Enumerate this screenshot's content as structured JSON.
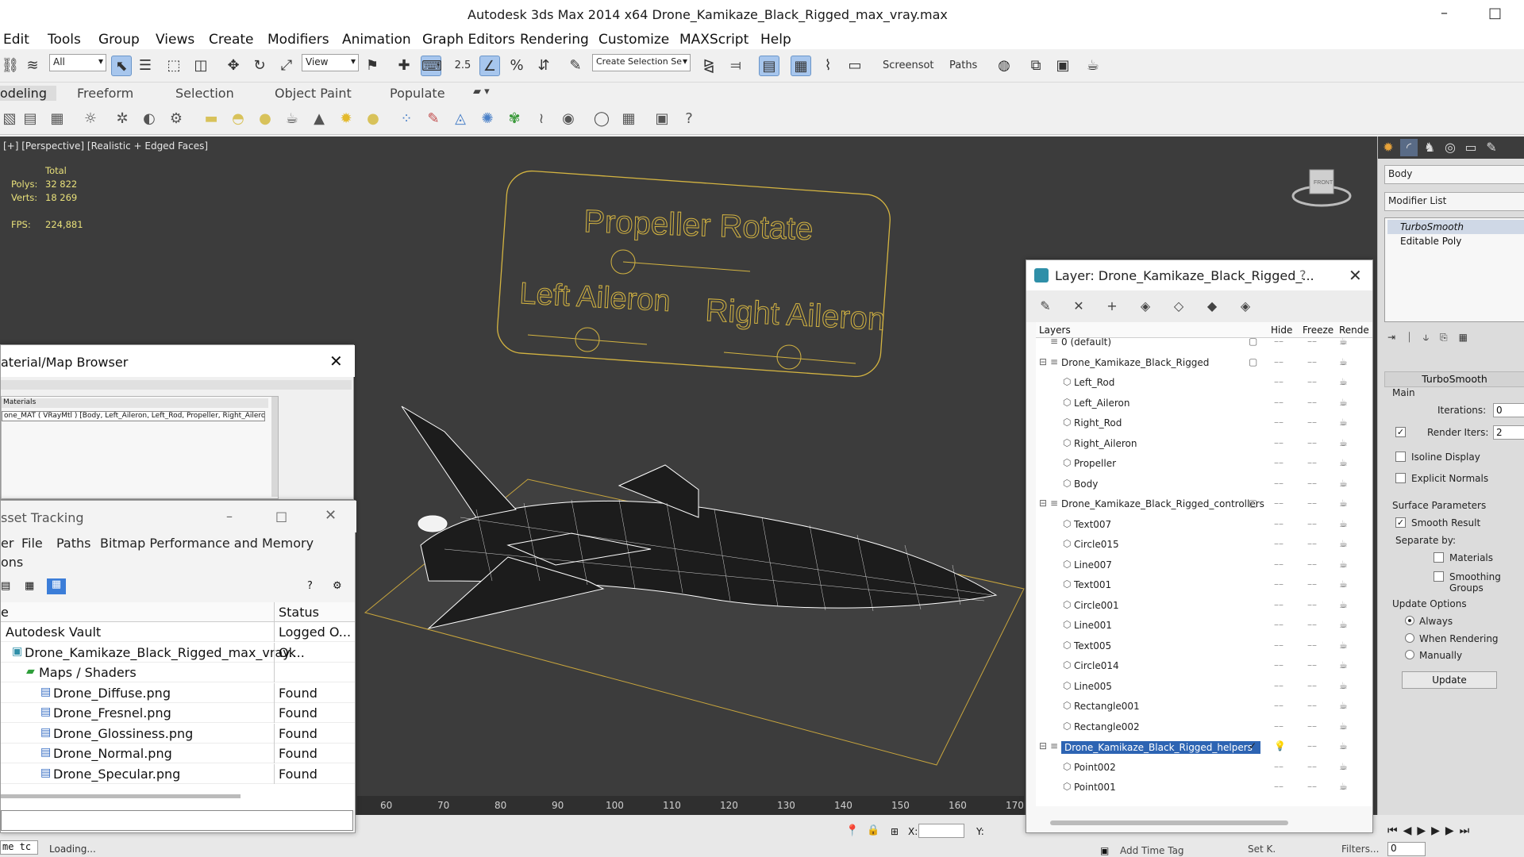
{
  "window": {
    "title": "Autodesk 3ds Max  2014 x64      Drone_Kamikaze_Black_Rigged_max_vray.max",
    "minimize_glyph": "–",
    "maximize_glyph": "□"
  },
  "menu": [
    "Edit",
    "Tools",
    "Group",
    "Views",
    "Create",
    "Modifiers",
    "Animation",
    "Graph Editors",
    "Rendering",
    "Customize",
    "MAXScript",
    "Help"
  ],
  "toolbar": {
    "filter_value": "All",
    "refcoord_value": "View",
    "selection_set_placeholder": "Create Selection Se",
    "snap_angle_label": "2.5",
    "screenshot_label": "Screensot",
    "paths_label": "Paths"
  },
  "ribbon_tabs": [
    "odeling",
    "Freeform",
    "Selection",
    "Object Paint",
    "Populate"
  ],
  "viewport": {
    "label": "[+] [Perspective] [Realistic + Edged Faces]",
    "stats_header": "Total",
    "polys_label": "Polys:",
    "polys_value": "32 822",
    "verts_label": "Verts:",
    "verts_value": "18 269",
    "fps_label": "FPS:",
    "fps_value": "224,881",
    "rig_labels": {
      "propeller": "Propeller Rotate",
      "left": "Left Aileron",
      "right": "Right Aileron"
    },
    "viewcube_label": "FRONT"
  },
  "timeline": {
    "ticks": [
      "60",
      "70",
      "80",
      "90",
      "100",
      "110",
      "120",
      "130",
      "140",
      "150",
      "160",
      "170"
    ]
  },
  "statusbar": {
    "loading": "Loading...",
    "script_prefix": "me  tc",
    "x_label": "X:",
    "y_label": "Y:",
    "add_time_tag": "Add Time Tag",
    "set_key": "Set K.",
    "filters": "Filters...",
    "frame_value": "0"
  },
  "command_panel": {
    "object_name": "Body",
    "modifier_list": "Modifier List",
    "stack": [
      "TurboSmooth",
      "Editable Poly"
    ],
    "turbosmooth_title": "TurboSmooth",
    "main_group": "Main",
    "iterations_label": "Iterations:",
    "iterations_value": "0",
    "render_iters_label": "Render Iters:",
    "render_iters_value": "2",
    "isoline_label": "Isoline Display",
    "explicit_normals_label": "Explicit Normals",
    "surface_group": "Surface Parameters",
    "smooth_result_label": "Smooth Result",
    "separate_by_label": "Separate by:",
    "materials_label": "Materials",
    "smoothing_groups_label": "Smoothing Groups",
    "update_group": "Update Options",
    "always_label": "Always",
    "when_rendering_label": "When Rendering",
    "manually_label": "Manually",
    "update_button": "Update"
  },
  "layer_dialog": {
    "title": "Layer: Drone_Kamikaze_Black_Rigged_...",
    "help_glyph": "?",
    "col_layers": "Layers",
    "col_hide": "Hide",
    "col_freeze": "Freeze",
    "col_render": "Rende",
    "rows": [
      {
        "name": "0 (default)",
        "level": 0,
        "box": true
      },
      {
        "name": "Drone_Kamikaze_Black_Rigged",
        "level": 0,
        "box": true,
        "expander": true
      },
      {
        "name": "Left_Rod",
        "level": 1
      },
      {
        "name": "Left_Aileron",
        "level": 1
      },
      {
        "name": "Right_Rod",
        "level": 1
      },
      {
        "name": "Right_Aileron",
        "level": 1
      },
      {
        "name": "Propeller",
        "level": 1
      },
      {
        "name": "Body",
        "level": 1
      },
      {
        "name": "Drone_Kamikaze_Black_Rigged_controllers",
        "level": 0,
        "box": true,
        "expander": true
      },
      {
        "name": "Text007",
        "level": 1
      },
      {
        "name": "Circle015",
        "level": 1
      },
      {
        "name": "Line007",
        "level": 1
      },
      {
        "name": "Text001",
        "level": 1
      },
      {
        "name": "Circle001",
        "level": 1
      },
      {
        "name": "Line001",
        "level": 1
      },
      {
        "name": "Text005",
        "level": 1
      },
      {
        "name": "Circle014",
        "level": 1
      },
      {
        "name": "Line005",
        "level": 1
      },
      {
        "name": "Rectangle001",
        "level": 1
      },
      {
        "name": "Rectangle002",
        "level": 1
      },
      {
        "name": "Drone_Kamikaze_Black_Rigged_helpers",
        "level": 0,
        "selected": true,
        "check": true,
        "expander": true
      },
      {
        "name": "Point002",
        "level": 1
      },
      {
        "name": "Point001",
        "level": 1
      }
    ]
  },
  "material_browser": {
    "title": "aterial/Map Browser",
    "section": "Materials",
    "item": "one_MAT ( VRayMtl ) [Body, Left_Aileron, Left_Rod, Propeller, Right_Ailero..."
  },
  "asset_tracking": {
    "title": "sset Tracking",
    "menu": [
      "er",
      "File",
      "Paths",
      "Bitmap Performance and Memory"
    ],
    "menu2": "ons",
    "col_name": "e",
    "col_status": "Status",
    "rows": [
      {
        "name": "Autodesk Vault",
        "status": "Logged O...",
        "indent": 0,
        "icon": "vault"
      },
      {
        "name": "Drone_Kamikaze_Black_Rigged_max_vray....",
        "status": "Ok",
        "indent": 1,
        "icon": "max-file"
      },
      {
        "name": "Maps / Shaders",
        "status": "",
        "indent": 2,
        "icon": "folder"
      },
      {
        "name": "Drone_Diffuse.png",
        "status": "Found",
        "indent": 3,
        "icon": "image"
      },
      {
        "name": "Drone_Fresnel.png",
        "status": "Found",
        "indent": 3,
        "icon": "image"
      },
      {
        "name": "Drone_Glossiness.png",
        "status": "Found",
        "indent": 3,
        "icon": "image"
      },
      {
        "name": "Drone_Normal.png",
        "status": "Found",
        "indent": 3,
        "icon": "image"
      },
      {
        "name": "Drone_Specular.png",
        "status": "Found",
        "indent": 3,
        "icon": "image"
      }
    ]
  },
  "colors": {
    "viewport_bg": "#3c3c3c",
    "rig_line": "#d4b441",
    "stats_text": "#e8e07a",
    "selection_blue": "#2d64b3"
  }
}
